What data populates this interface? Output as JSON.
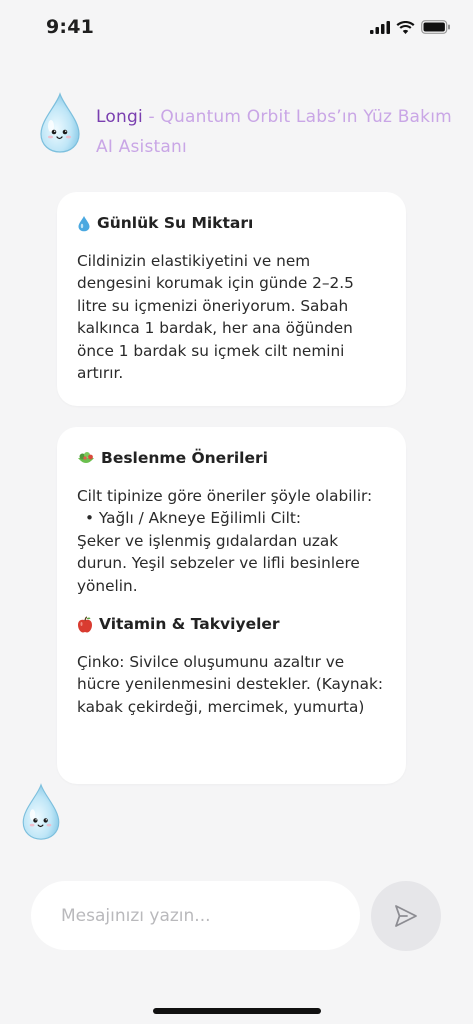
{
  "status_bar": {
    "time": "9:41",
    "icons": [
      "signal-icon",
      "wifi-icon",
      "battery-icon"
    ]
  },
  "header": {
    "brand": "Longi",
    "subtitle": " - Quantum Orbit Labs’ın Yüz Bakım AI Asistanı",
    "avatar_icon": "water-drop-mascot-icon"
  },
  "cards": [
    {
      "heading_icon": "droplet-icon",
      "heading": "Günlük Su Miktarı",
      "text": "Cildinizin elastikiyetini ve nem dengesini korumak için günde 2–2.5 litre su içmenizi öneriyorum. Sabah kalkınca 1 bardak, her ana öğünden önce 1 bardak su içmek cilt nemini artırır."
    },
    {
      "heading_icon": "salad-icon",
      "heading": "Beslenme Önerileri",
      "intro": "Cilt tipinize göre öneriler şöyle olabilir:",
      "bullet": "•  Yağlı / Akneye Eğilimli Cilt:",
      "bullet_text": "Şeker ve işlenmiş gıdalardan uzak durun. Yeşil sebzeler ve lifli besinlere yönelin.",
      "heading2_icon": "apple-icon",
      "heading2": "Vitamin & Takviyeler",
      "text2": "Çinko: Sivilce oluşumunu azaltır ve hücre yenilenmesini destekler. (Kaynak: kabak çekirdeği, mercimek, yumurta)"
    }
  ],
  "input": {
    "placeholder": "Mesajınızı yazın...",
    "value": ""
  },
  "send_icon": "send-icon",
  "colors": {
    "brand": "#7a3fb0",
    "subtitle": "#c9a6e6",
    "background": "#f5f5f6",
    "card": "#ffffff"
  }
}
